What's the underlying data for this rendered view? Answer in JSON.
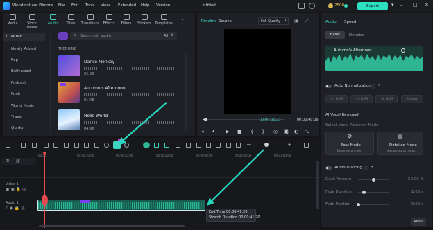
{
  "app": {
    "name": "Wondershare Filmora",
    "project_title": "Untitled",
    "credits": "2500",
    "export_label": "Export"
  },
  "menu": [
    "File",
    "Edit",
    "Tools",
    "View",
    "Extended",
    "Help",
    "Version"
  ],
  "media_tabs": [
    {
      "label": "Media",
      "icon": "media-icon"
    },
    {
      "label": "Stock Media",
      "icon": "stock-media-icon"
    },
    {
      "label": "Audio",
      "icon": "music-note-icon",
      "active": true
    },
    {
      "label": "Titles",
      "icon": "titles-icon"
    },
    {
      "label": "Transitions",
      "icon": "transitions-icon"
    },
    {
      "label": "Effects",
      "icon": "effects-icon"
    },
    {
      "label": "Filters",
      "icon": "filters-icon"
    },
    {
      "label": "Stickers",
      "icon": "stickers-icon"
    },
    {
      "label": "Templates",
      "icon": "templates-icon"
    }
  ],
  "audio_sidebar": {
    "header": "Music",
    "items": [
      "Newly Added",
      "Pop",
      "Bollywood",
      "Podcast",
      "Funk",
      "World Music",
      "Travel",
      "Quirky"
    ]
  },
  "search": {
    "placeholder": "Search all audio",
    "filter_label": "All"
  },
  "trending": {
    "heading": "TRENDING",
    "tracks": [
      {
        "title": "Dance Monkey",
        "duration": "02:08"
      },
      {
        "title": "Autumn's Afternoon",
        "duration": "01:48"
      },
      {
        "title": "Hello World",
        "duration": "04:48"
      }
    ]
  },
  "player": {
    "tabs": [
      "Timeline",
      "Source"
    ],
    "quality": "Full Quality",
    "current_time": "00:00:01:23",
    "total_time": "00:00:40:06",
    "progress": 0.04
  },
  "right_panel": {
    "tabs": [
      "Audio",
      "Speed"
    ],
    "subtabs": [
      "Basic",
      "Denoise"
    ],
    "clip_name": "Autumn's Afternoon",
    "auto_normalization": {
      "label": "Auto Normalization",
      "buttons": [
        "-14 LUFS",
        "-16 LUFS",
        "-18 LUFS",
        "Custom"
      ]
    },
    "vocal_remover": {
      "heading": "AI Vocal Remover",
      "mode_label": "Select Vocal Remover Mode"
    },
    "modes": [
      {
        "title": "Fast Mode",
        "desc": "Single vocal track"
      },
      {
        "title": "Detailed Mode",
        "desc": "Multiple vocal tracks"
      }
    ],
    "ducking": {
      "label": "Audio Ducking",
      "rows": [
        {
          "label": "Duck Amount",
          "value": "50.00 %",
          "level": 0.5
        },
        {
          "label": "Fade Duration",
          "value": "2.00 s",
          "level": 0.2
        },
        {
          "label": "Fade Position",
          "value": "0.00 s",
          "level": 0.0
        }
      ]
    },
    "reset_label": "Reset"
  },
  "timeline": {
    "ruler": [
      "00:00",
      "00:00:10:00",
      "00:00:20:00",
      "00:00:30:00",
      "00:00:40:00",
      "00:00:50:00",
      "00:01:00:00"
    ],
    "tracks": {
      "video": "Video 1",
      "audio": "Audio 1"
    },
    "tooltip": {
      "end_time": "End Time:00:00:41:20",
      "stretch": "Stretch Duration:00:00:41:20"
    }
  },
  "colors": {
    "accent": "#3fd3c0",
    "export": "#2de0c2",
    "playhead": "#e5484d",
    "waveform": "#1f8f77",
    "arrow": "#27d8c0"
  }
}
